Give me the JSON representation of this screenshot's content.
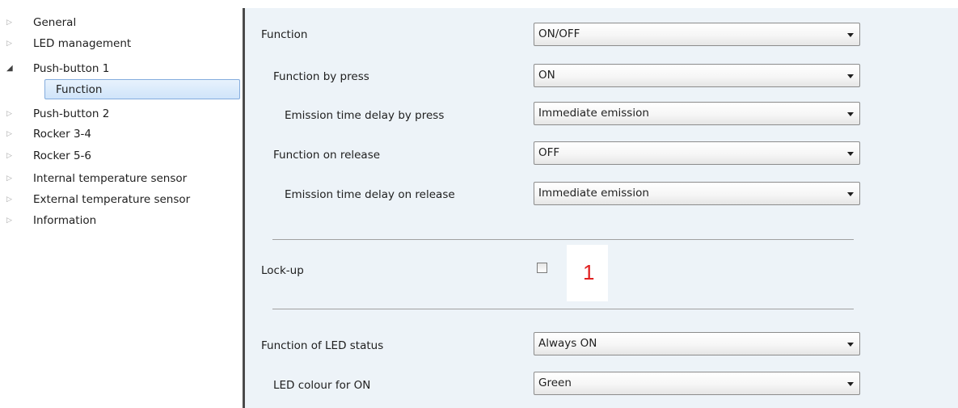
{
  "tree": {
    "items": [
      {
        "label": "General",
        "arrow": "▷"
      },
      {
        "label": "LED management",
        "arrow": "▷"
      },
      {
        "label": "Push-button 1",
        "arrow": "◢"
      },
      {
        "label": "Push-button 2",
        "arrow": "▷"
      },
      {
        "label": "Rocker 3-4",
        "arrow": "▷"
      },
      {
        "label": "Rocker 5-6",
        "arrow": "▷"
      },
      {
        "label": "Internal temperature sensor",
        "arrow": "▷"
      },
      {
        "label": "External temperature sensor",
        "arrow": "▷"
      },
      {
        "label": "Information",
        "arrow": "▷"
      }
    ],
    "selected_child": "Function"
  },
  "params": {
    "function": {
      "label": "Function",
      "value": "ON/OFF"
    },
    "function_by_press": {
      "label": "Function by press",
      "value": "ON"
    },
    "emission_delay_press": {
      "label": "Emission time delay by press",
      "value": "Immediate emission"
    },
    "function_on_release": {
      "label": "Function on release",
      "value": "OFF"
    },
    "emission_delay_release": {
      "label": "Emission time delay on release",
      "value": "Immediate emission"
    },
    "lock_up": {
      "label": "Lock-up",
      "checked": false
    },
    "led_status": {
      "label": "Function of LED status",
      "value": "Always ON"
    },
    "led_colour_on": {
      "label": "LED colour for ON",
      "value": "Green"
    }
  },
  "callout": {
    "number": "1",
    "color": "#e02020"
  },
  "colors": {
    "content_bg": "#edf3f8",
    "selection": "#cfe4fa",
    "divider": "#4a4a4a"
  }
}
